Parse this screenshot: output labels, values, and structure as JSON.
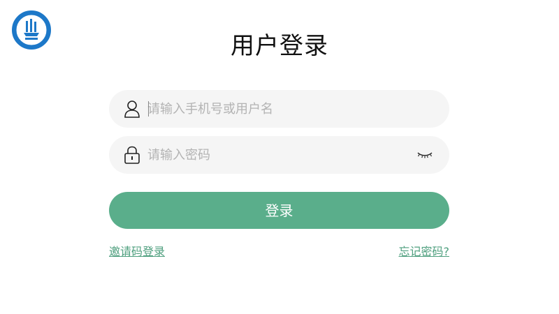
{
  "header": {
    "title": "用户登录"
  },
  "form": {
    "username_placeholder": "请输入手机号或用户名",
    "password_placeholder": "请输入密码",
    "login_label": "登录"
  },
  "links": {
    "invite_code_login": "邀请码登录",
    "forgot_password": "忘记密码?"
  },
  "colors": {
    "accent": "#5aae8b",
    "link": "#4e9f7e",
    "field_bg": "#f5f5f5",
    "logo_blue": "#1d78c8"
  },
  "icons": {
    "logo": "school-logo",
    "username": "user-icon",
    "password": "lock-icon",
    "toggle": "eye-closed-icon"
  }
}
